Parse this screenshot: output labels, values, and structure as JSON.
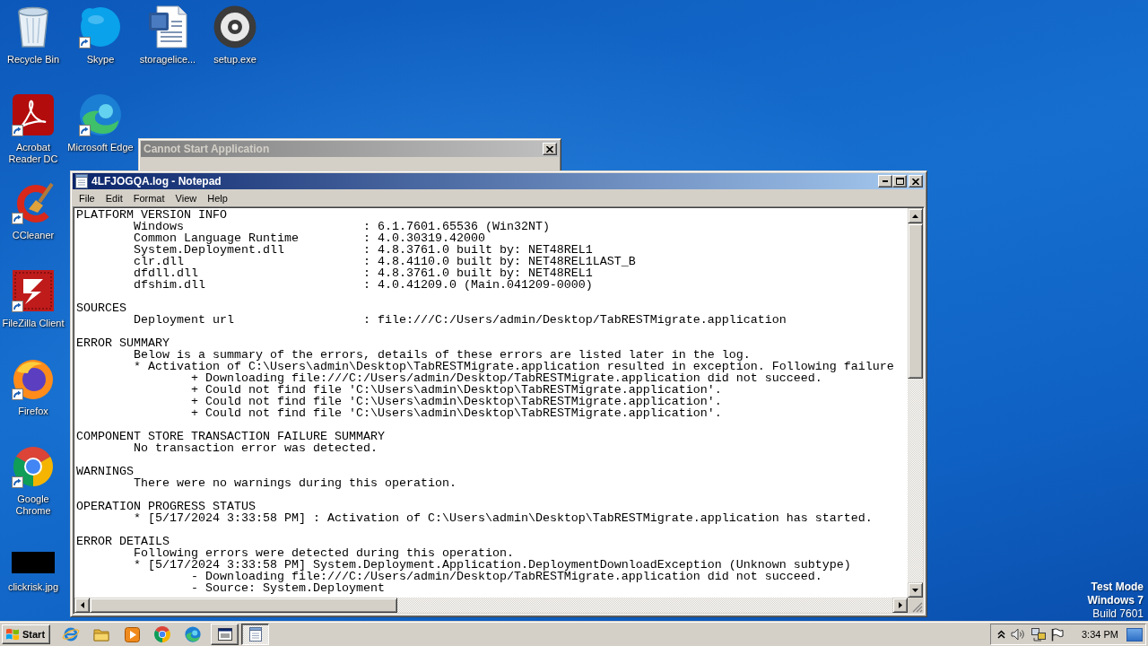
{
  "desktop": {
    "icons": [
      {
        "label": "Recycle Bin",
        "kind": "recycle-bin",
        "shortcut": false
      },
      {
        "label": "Skype",
        "kind": "skype",
        "shortcut": true
      },
      {
        "label": "storagelice...",
        "kind": "word-doc",
        "shortcut": false
      },
      {
        "label": "setup.exe",
        "kind": "disc",
        "shortcut": false
      },
      {
        "label": "Acrobat Reader DC",
        "kind": "acrobat",
        "shortcut": true
      },
      {
        "label": "Microsoft Edge",
        "kind": "edge",
        "shortcut": true
      },
      {
        "label": "CCleaner",
        "kind": "ccleaner",
        "shortcut": true
      },
      {
        "label": "FileZilla Client",
        "kind": "filezilla",
        "shortcut": true
      },
      {
        "label": "Firefox",
        "kind": "firefox",
        "shortcut": true
      },
      {
        "label": "Google Chrome",
        "kind": "chrome",
        "shortcut": true
      },
      {
        "label": "clickrisk.jpg",
        "kind": "photo",
        "shortcut": false
      }
    ],
    "system_text": [
      {
        "text": "Test Mode",
        "kind": "heading"
      },
      {
        "text": "Windows 7",
        "kind": "heading"
      },
      {
        "text": "Build 7601",
        "kind": "detail"
      }
    ]
  },
  "dialog": {
    "title": "Cannot Start Application",
    "active": false
  },
  "notepad": {
    "title": "4LFJOGQA.log - Notepad",
    "active": true,
    "menu": [
      "File",
      "Edit",
      "Format",
      "View",
      "Help"
    ],
    "sections": [
      {
        "heading": "PLATFORM VERSION INFO",
        "lines": [
          {
            "kind": "field",
            "label": "Windows",
            "value": ": 6.1.7601.65536 (Win32NT)"
          },
          {
            "kind": "field",
            "label": "Common Language Runtime",
            "value": ": 4.0.30319.42000"
          },
          {
            "kind": "field",
            "label": "System.Deployment.dll",
            "value": ": 4.8.3761.0 built by: NET48REL1"
          },
          {
            "kind": "field",
            "label": "clr.dll",
            "value": ": 4.8.4110.0 built by: NET48REL1LAST_B"
          },
          {
            "kind": "field",
            "label": "dfdll.dll",
            "value": ": 4.8.3761.0 built by: NET48REL1"
          },
          {
            "kind": "field",
            "label": "dfshim.dll",
            "value": ": 4.0.41209.0 (Main.041209-0000)"
          }
        ]
      },
      {
        "heading": "SOURCES",
        "lines": [
          {
            "kind": "field",
            "label": "Deployment url",
            "value": ": file:///C:/Users/admin/Desktop/TabRESTMigrate.application"
          }
        ]
      },
      {
        "heading": "ERROR SUMMARY",
        "lines": [
          {
            "kind": "text",
            "text": "Below is a summary of the errors, details of these errors are listed later in the log."
          },
          {
            "kind": "text",
            "text": "* Activation of C:\\Users\\admin\\Desktop\\TabRESTMigrate.application resulted in exception. Following failure",
            "children": [
              {
                "kind": "text",
                "text": "+ Downloading file:///C:/Users/admin/Desktop/TabRESTMigrate.application did not succeed."
              },
              {
                "kind": "text",
                "text": "+ Could not find file 'C:\\Users\\admin\\Desktop\\TabRESTMigrate.application'."
              },
              {
                "kind": "text",
                "text": "+ Could not find file 'C:\\Users\\admin\\Desktop\\TabRESTMigrate.application'."
              },
              {
                "kind": "text",
                "text": "+ Could not find file 'C:\\Users\\admin\\Desktop\\TabRESTMigrate.application'."
              }
            ]
          }
        ]
      },
      {
        "heading": "COMPONENT STORE TRANSACTION FAILURE SUMMARY",
        "lines": [
          {
            "kind": "text",
            "text": "No transaction error was detected."
          }
        ]
      },
      {
        "heading": "WARNINGS",
        "lines": [
          {
            "kind": "text",
            "text": "There were no warnings during this operation."
          }
        ]
      },
      {
        "heading": "OPERATION PROGRESS STATUS",
        "lines": [
          {
            "kind": "text",
            "text": "* [5/17/2024 3:33:58 PM] : Activation of C:\\Users\\admin\\Desktop\\TabRESTMigrate.application has started."
          }
        ]
      },
      {
        "heading": "ERROR DETAILS",
        "lines": [
          {
            "kind": "text",
            "text": "Following errors were detected during this operation."
          },
          {
            "kind": "text",
            "text": "* [5/17/2024 3:33:58 PM] System.Deployment.Application.DeploymentDownloadException (Unknown subtype)",
            "children": [
              {
                "kind": "text",
                "text": "- Downloading file:///C:/Users/admin/Desktop/TabRESTMigrate.application did not succeed."
              },
              {
                "kind": "text",
                "text": "- Source: System.Deployment"
              }
            ]
          }
        ]
      }
    ]
  },
  "taskbar": {
    "start": "Start",
    "quick_launch": [
      {
        "kind": "internet-explorer"
      },
      {
        "kind": "explorer"
      },
      {
        "kind": "media-player"
      },
      {
        "kind": "chrome"
      },
      {
        "kind": "edge"
      }
    ],
    "tasks": [
      {
        "kind": "dialog",
        "selected": false
      },
      {
        "kind": "notepad",
        "selected": true
      }
    ],
    "tray": [
      {
        "kind": "chevron"
      },
      {
        "kind": "speaker"
      },
      {
        "kind": "network"
      },
      {
        "kind": "flag"
      }
    ],
    "clock": "3:34 PM"
  }
}
